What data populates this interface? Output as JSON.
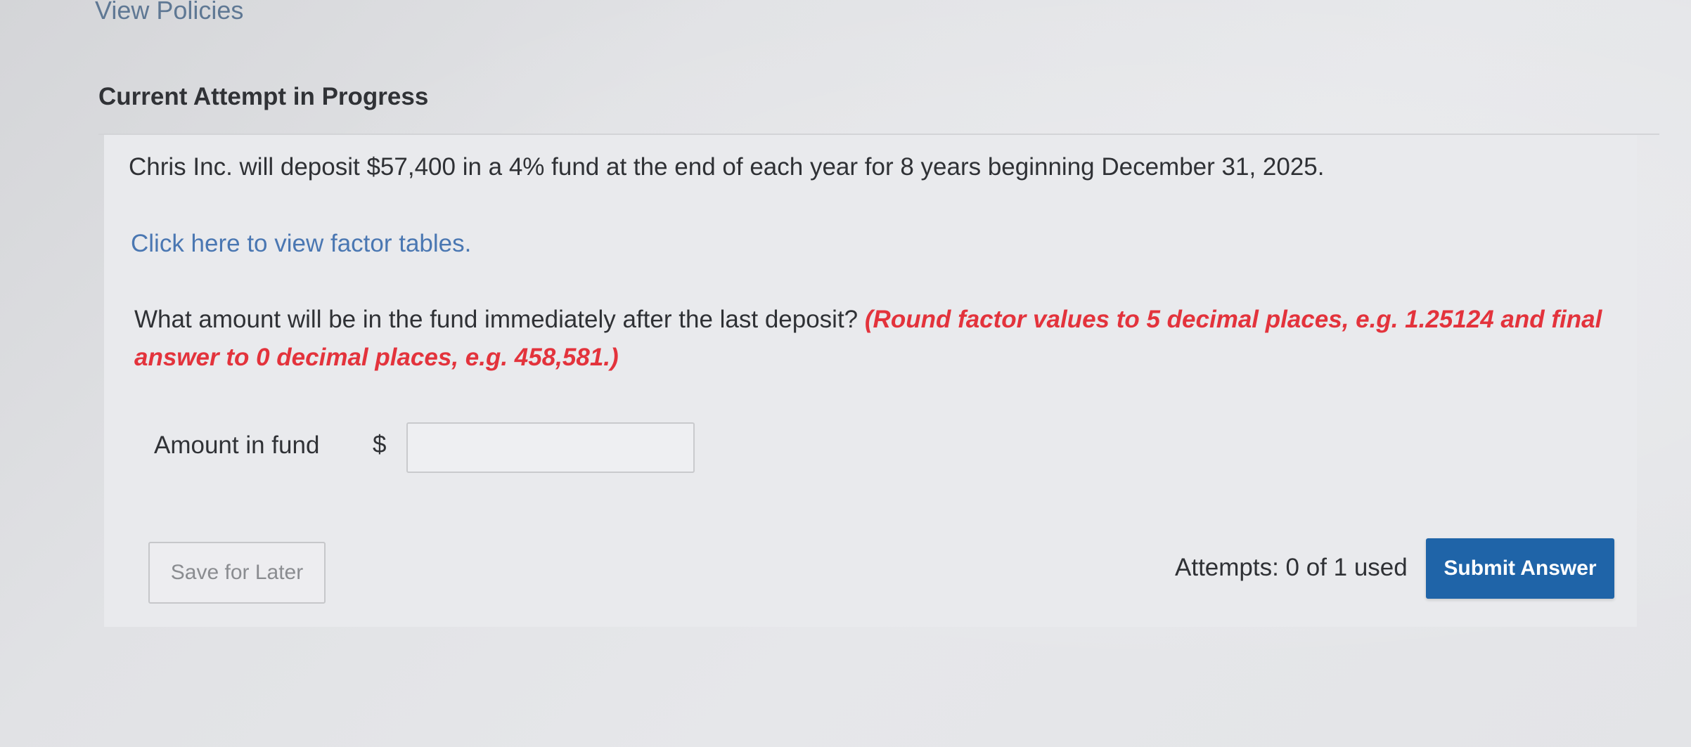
{
  "header": {
    "view_policies_link": "View Policies"
  },
  "attempt": {
    "heading": "Current Attempt in Progress"
  },
  "question": {
    "problem_statement": "Chris Inc. will deposit $57,400 in a 4% fund at the end of each year for 8 years beginning December 31, 2025.",
    "factor_tables_link": "Click here to view factor tables.",
    "prompt": "What amount will be in the fund immediately after the last deposit?",
    "instruction": "(Round factor values to 5 decimal places, e.g. 1.25124 and final answer to 0 decimal places, e.g. 458,581.)"
  },
  "answer": {
    "field_label": "Amount in fund",
    "currency_symbol": "$",
    "value": ""
  },
  "footer": {
    "save_label": "Save for Later",
    "attempts_text": "Attempts: 0 of 1 used",
    "submit_label": "Submit Answer"
  },
  "colors": {
    "link": "#4a77b2",
    "instruction_red": "#e3333c",
    "submit_blue": "#1f64a8"
  }
}
